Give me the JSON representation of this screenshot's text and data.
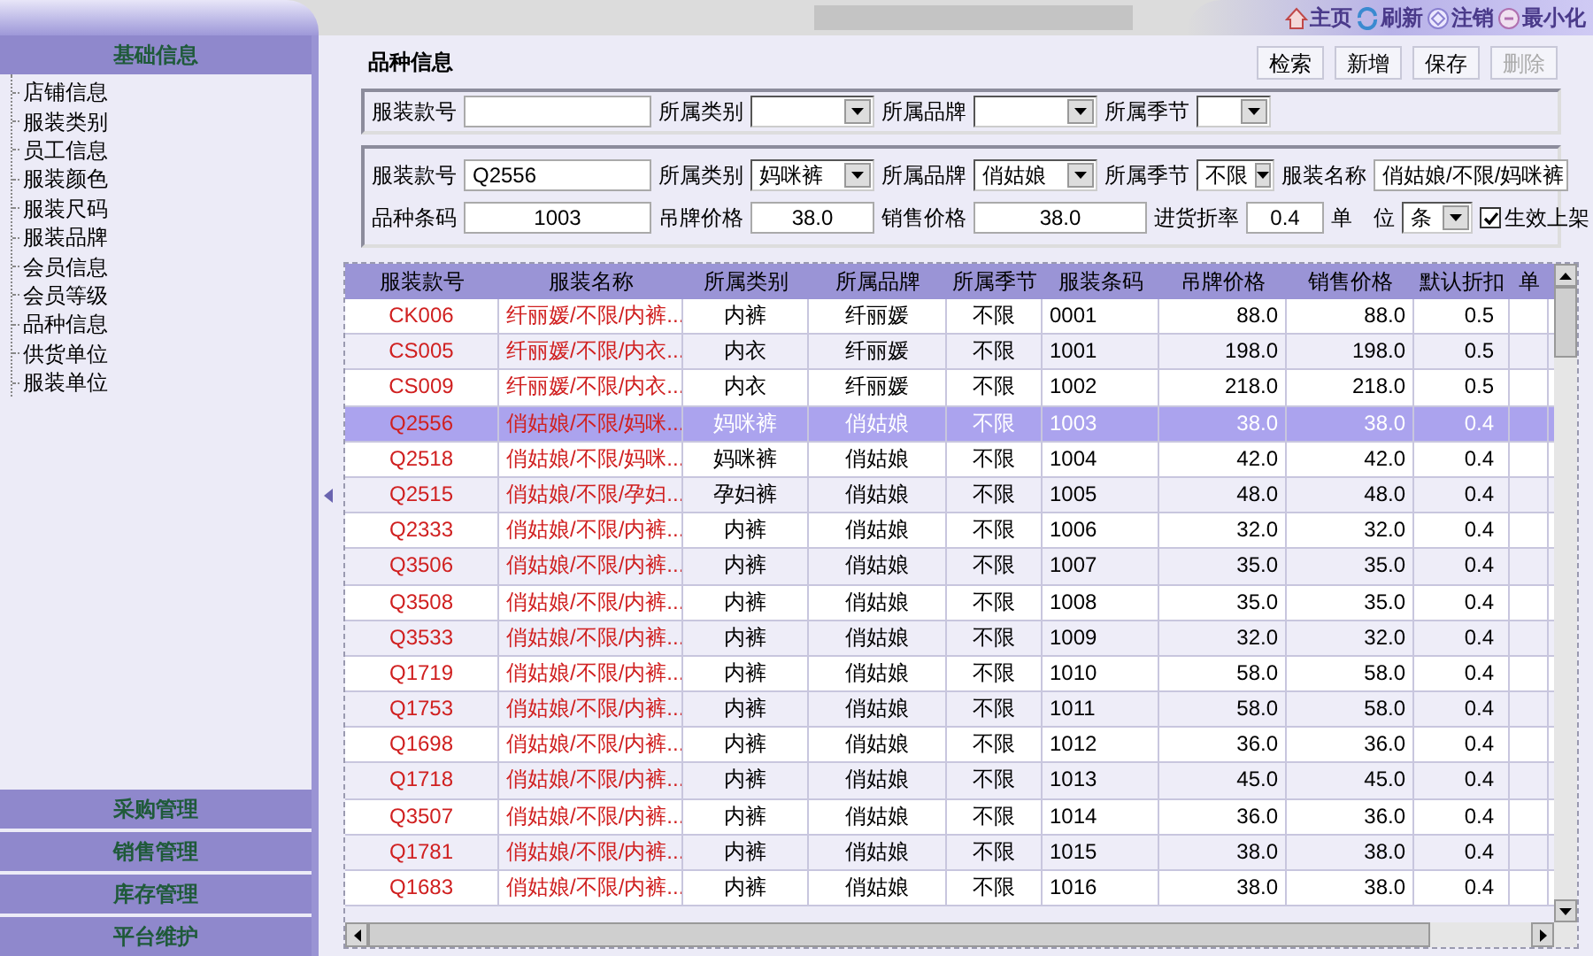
{
  "top_nav": [
    {
      "kind": "home",
      "label": "主页"
    },
    {
      "kind": "refresh",
      "label": "刷新"
    },
    {
      "kind": "logout",
      "label": "注销"
    },
    {
      "kind": "minimize",
      "label": "最小化"
    }
  ],
  "sidebar": {
    "title": "基础信息",
    "items": [
      "店铺信息",
      "服装类别",
      "员工信息",
      "服装颜色",
      "服装尺码",
      "服装品牌",
      "会员信息",
      "会员等级",
      "品种信息",
      "供货单位",
      "服装单位"
    ],
    "sections": [
      "采购管理",
      "销售管理",
      "库存管理",
      "平台维护"
    ]
  },
  "page_title": "品种信息",
  "buttons": [
    {
      "label": "检索",
      "disabled": false
    },
    {
      "label": "新增",
      "disabled": false
    },
    {
      "label": "保存",
      "disabled": false
    },
    {
      "label": "删除",
      "disabled": true
    }
  ],
  "search": {
    "code_label": "服装款号",
    "category_label": "所属类别",
    "brand_label": "所属品牌",
    "season_label": "所属季节"
  },
  "detail": {
    "code_label": "服装款号",
    "code": "Q2556",
    "category_label": "所属类别",
    "category": "妈咪裤",
    "brand_label": "所属品牌",
    "brand": "俏姑娘",
    "season_label": "所属季节",
    "season": "不限",
    "name_label": "服装名称",
    "name": "俏姑娘/不限/妈咪裤",
    "barcode_label": "品种条码",
    "barcode": "1003",
    "tag_price_label": "吊牌价格",
    "tag_price": "38.0",
    "sale_price_label": "销售价格",
    "sale_price": "38.0",
    "discount_label": "进货折率",
    "discount": "0.4",
    "unit_label": "单　位",
    "unit": "条",
    "active_label": "生效上架",
    "active": true
  },
  "table": {
    "columns": [
      "服装款号",
      "服装名称",
      "所属类别",
      "所属品牌",
      "所属季节",
      "服装条码",
      "吊牌价格",
      "销售价格",
      "默认折扣",
      "单"
    ],
    "rows": [
      {
        "selected": false,
        "cells": [
          "CK006",
          "纤丽媛/不限/内裤...",
          "内裤",
          "纤丽媛",
          "不限",
          "0001",
          "88.0",
          "88.0",
          "0.5"
        ]
      },
      {
        "selected": false,
        "cells": [
          "CS005",
          "纤丽媛/不限/内衣...",
          "内衣",
          "纤丽媛",
          "不限",
          "1001",
          "198.0",
          "198.0",
          "0.5"
        ]
      },
      {
        "selected": false,
        "cells": [
          "CS009",
          "纤丽媛/不限/内衣...",
          "内衣",
          "纤丽媛",
          "不限",
          "1002",
          "218.0",
          "218.0",
          "0.5"
        ]
      },
      {
        "selected": true,
        "cells": [
          "Q2556",
          "俏姑娘/不限/妈咪...",
          "妈咪裤",
          "俏姑娘",
          "不限",
          "1003",
          "38.0",
          "38.0",
          "0.4"
        ]
      },
      {
        "selected": false,
        "cells": [
          "Q2518",
          "俏姑娘/不限/妈咪...",
          "妈咪裤",
          "俏姑娘",
          "不限",
          "1004",
          "42.0",
          "42.0",
          "0.4"
        ]
      },
      {
        "selected": false,
        "cells": [
          "Q2515",
          "俏姑娘/不限/孕妇...",
          "孕妇裤",
          "俏姑娘",
          "不限",
          "1005",
          "48.0",
          "48.0",
          "0.4"
        ]
      },
      {
        "selected": false,
        "cells": [
          "Q2333",
          "俏姑娘/不限/内裤...",
          "内裤",
          "俏姑娘",
          "不限",
          "1006",
          "32.0",
          "32.0",
          "0.4"
        ]
      },
      {
        "selected": false,
        "cells": [
          "Q3506",
          "俏姑娘/不限/内裤...",
          "内裤",
          "俏姑娘",
          "不限",
          "1007",
          "35.0",
          "35.0",
          "0.4"
        ]
      },
      {
        "selected": false,
        "cells": [
          "Q3508",
          "俏姑娘/不限/内裤...",
          "内裤",
          "俏姑娘",
          "不限",
          "1008",
          "35.0",
          "35.0",
          "0.4"
        ]
      },
      {
        "selected": false,
        "cells": [
          "Q3533",
          "俏姑娘/不限/内裤...",
          "内裤",
          "俏姑娘",
          "不限",
          "1009",
          "32.0",
          "32.0",
          "0.4"
        ]
      },
      {
        "selected": false,
        "cells": [
          "Q1719",
          "俏姑娘/不限/内裤...",
          "内裤",
          "俏姑娘",
          "不限",
          "1010",
          "58.0",
          "58.0",
          "0.4"
        ]
      },
      {
        "selected": false,
        "cells": [
          "Q1753",
          "俏姑娘/不限/内裤...",
          "内裤",
          "俏姑娘",
          "不限",
          "1011",
          "58.0",
          "58.0",
          "0.4"
        ]
      },
      {
        "selected": false,
        "cells": [
          "Q1698",
          "俏姑娘/不限/内裤...",
          "内裤",
          "俏姑娘",
          "不限",
          "1012",
          "36.0",
          "36.0",
          "0.4"
        ]
      },
      {
        "selected": false,
        "cells": [
          "Q1718",
          "俏姑娘/不限/内裤...",
          "内裤",
          "俏姑娘",
          "不限",
          "1013",
          "45.0",
          "45.0",
          "0.4"
        ]
      },
      {
        "selected": false,
        "cells": [
          "Q3507",
          "俏姑娘/不限/内裤...",
          "内裤",
          "俏姑娘",
          "不限",
          "1014",
          "36.0",
          "36.0",
          "0.4"
        ]
      },
      {
        "selected": false,
        "cells": [
          "Q1781",
          "俏姑娘/不限/内裤...",
          "内裤",
          "俏姑娘",
          "不限",
          "1015",
          "38.0",
          "38.0",
          "0.4"
        ]
      },
      {
        "selected": false,
        "cells": [
          "Q1683",
          "俏姑娘/不限/内裤...",
          "内裤",
          "俏姑娘",
          "不限",
          "1016",
          "38.0",
          "38.0",
          "0.4"
        ]
      }
    ]
  }
}
